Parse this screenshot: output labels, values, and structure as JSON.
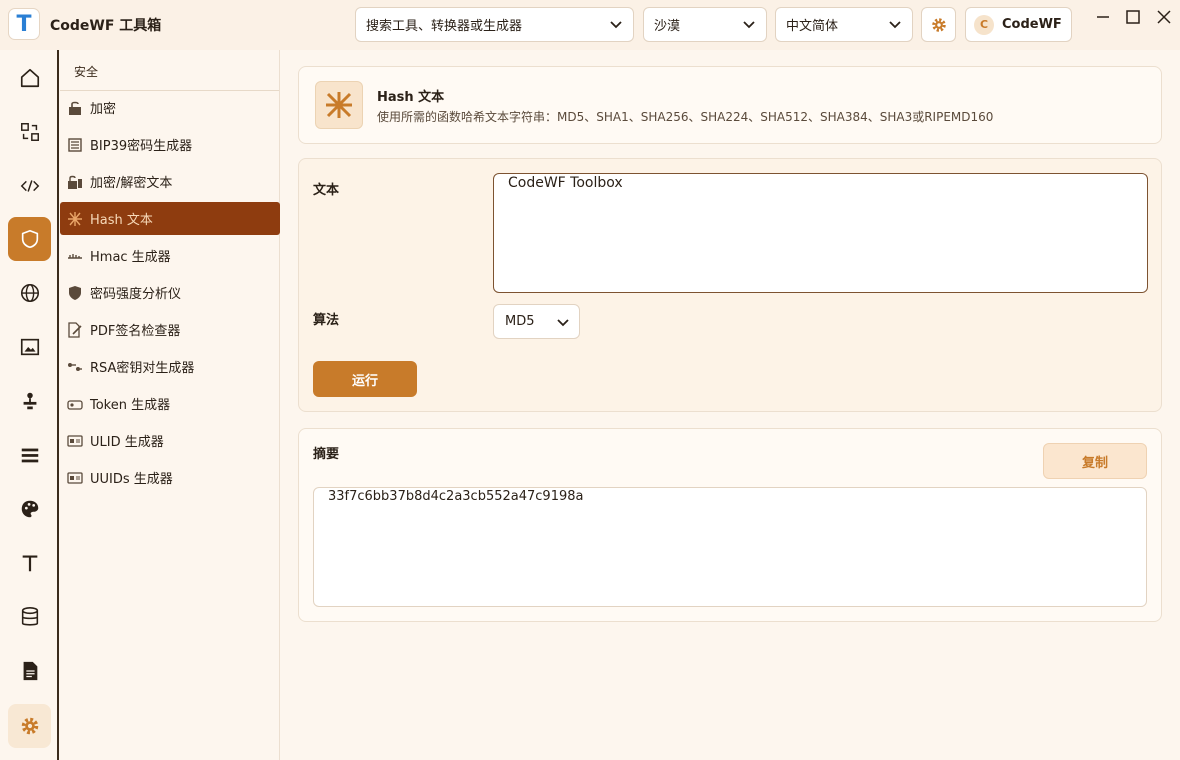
{
  "app": {
    "logo_letter": "T",
    "title": "CodeWF 工具箱"
  },
  "header": {
    "search_placeholder": "搜索工具、转换器或生成器",
    "theme": "沙漠",
    "language": "中文简体",
    "user_avatar_letter": "C",
    "user_name": "CodeWF"
  },
  "iconbar": {
    "items": [
      {
        "icon": "home-icon"
      },
      {
        "icon": "convert-icon"
      },
      {
        "icon": "code-icon"
      },
      {
        "icon": "shield-icon",
        "active": true
      },
      {
        "icon": "globe-icon"
      },
      {
        "icon": "image-icon"
      },
      {
        "icon": "joystick-icon"
      },
      {
        "icon": "list-icon"
      },
      {
        "icon": "palette-icon"
      },
      {
        "icon": "text-icon"
      },
      {
        "icon": "database-icon"
      },
      {
        "icon": "document-icon"
      },
      {
        "icon": "settings-icon"
      }
    ]
  },
  "menu": {
    "title": "安全",
    "items": [
      {
        "label": "加密"
      },
      {
        "label": "BIP39密码生成器"
      },
      {
        "label": "加密/解密文本"
      },
      {
        "label": "Hash 文本",
        "active": true
      },
      {
        "label": "Hmac 生成器"
      },
      {
        "label": "密码强度分析仪"
      },
      {
        "label": "PDF签名检查器"
      },
      {
        "label": "RSA密钥对生成器"
      },
      {
        "label": "Token 生成器"
      },
      {
        "label": "ULID 生成器"
      },
      {
        "label": "UUIDs 生成器"
      }
    ]
  },
  "tool": {
    "title": "Hash 文本",
    "description": "使用所需的函数哈希文本字符串：MD5、SHA1、SHA256、SHA224、SHA512、SHA384、SHA3或RIPEMD160"
  },
  "form": {
    "text_label": "文本",
    "text_value": "CodeWF Toolbox",
    "algo_label": "算法",
    "algo_value": "MD5",
    "run_label": "运行"
  },
  "output": {
    "label": "摘要",
    "copy_label": "复制",
    "value": "33f7c6bb37b8d4c2a3cb552a47c9198a"
  },
  "colors": {
    "accent": "#c87b2a",
    "menu_active_bg": "#8e3c0f",
    "background": "#fdf6ee"
  }
}
